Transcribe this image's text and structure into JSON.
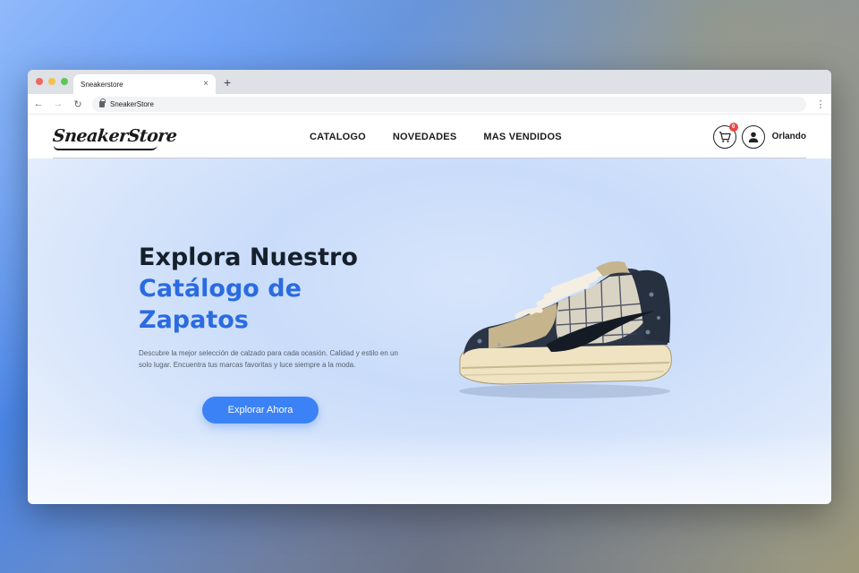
{
  "browser": {
    "tab_title": "Sneakerstore",
    "tab_close": "×",
    "new_tab": "+",
    "url": "SneakerStore",
    "back": "←",
    "forward": "→",
    "reload": "↻",
    "menu": "⋮"
  },
  "site": {
    "logo": "SneakerStore",
    "nav": [
      "CATALOGO",
      "NOVEDADES",
      "MAS VENDIDOS"
    ],
    "cart_count": "0",
    "username": "Orlando"
  },
  "hero": {
    "title_line1": "Explora Nuestro",
    "title_line2": "Catálogo de",
    "title_line3": "Zapatos",
    "description": "Descubre la mejor selección de calzado para cada ocasión. Calidad y estilo en un solo lugar. Encuentra tus marcas favoritas y luce siempre a la moda.",
    "cta_label": "Explorar Ahora"
  },
  "colors": {
    "accent": "#2a6be0",
    "button": "#3b82f6",
    "badge": "#ef4444",
    "title_dark": "#16202c"
  },
  "icons": {
    "cart": "cart-icon",
    "user": "user-icon",
    "lock": "lock-icon"
  }
}
